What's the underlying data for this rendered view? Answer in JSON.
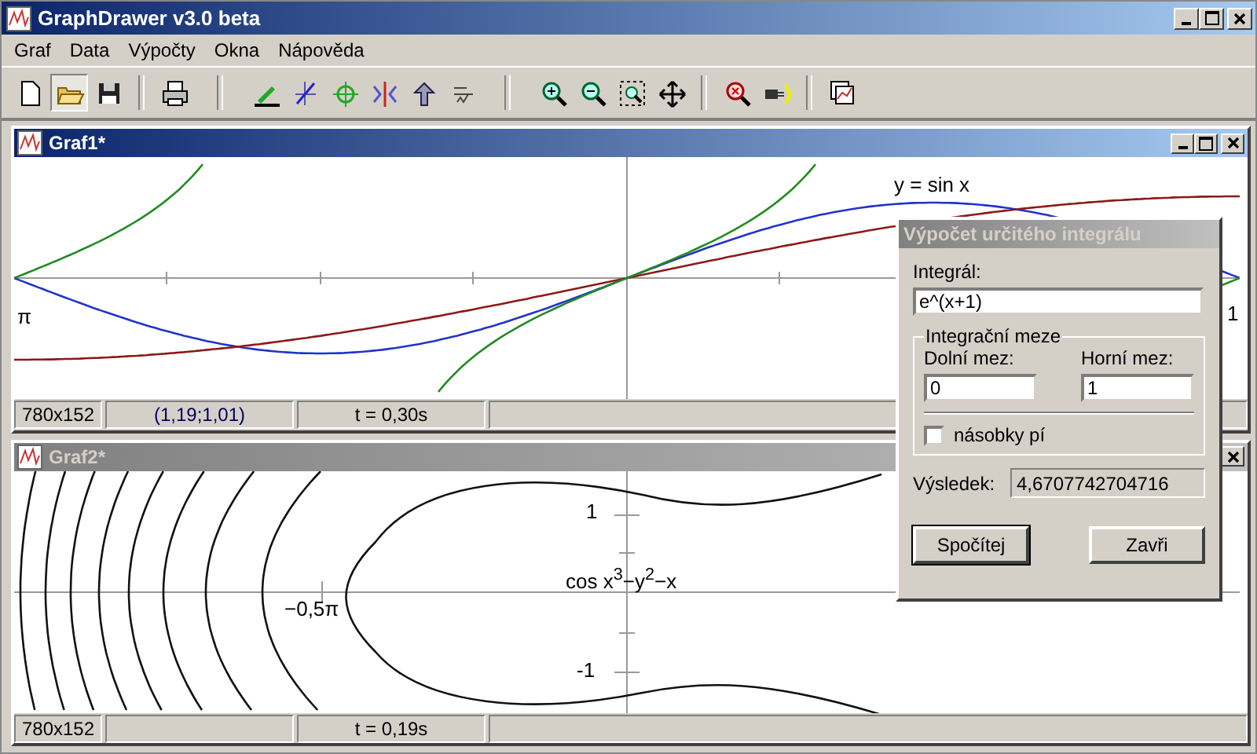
{
  "window": {
    "title": "GraphDrawer v3.0 beta"
  },
  "menu": [
    "Graf",
    "Data",
    "Výpočty",
    "Okna",
    "Nápověda"
  ],
  "graphs": [
    {
      "title": "Graf1*",
      "active": true,
      "kind": "functions",
      "labels": [
        "y = sin x",
        "π",
        "1"
      ],
      "status": {
        "size": "780x152",
        "coords": "(1,19;1,01)",
        "time": "t = 0,30s"
      }
    },
    {
      "title": "Graf2*",
      "active": false,
      "kind": "contour",
      "labels": [
        "1",
        "-1",
        "−0,5π",
        "cos x$^{3}$−y$^{2}$−x"
      ],
      "status": {
        "size": "780x152",
        "time": "t = 0,19s"
      }
    }
  ],
  "dialog": {
    "title": "Výpočet určitého integrálu",
    "integral_label": "Integrál:",
    "integral_value": "e^(x+1)",
    "group_title": "Integrační meze",
    "lower_label": "Dolní mez:",
    "lower_value": "0",
    "upper_label": "Horní mez:",
    "upper_value": "1",
    "pi_multiples": {
      "label": "násobky pí",
      "checked": false
    },
    "result_label": "Výsledek:",
    "result_value": "4,6707742704716",
    "buttons": [
      "Spočítej",
      "Zavři"
    ]
  }
}
